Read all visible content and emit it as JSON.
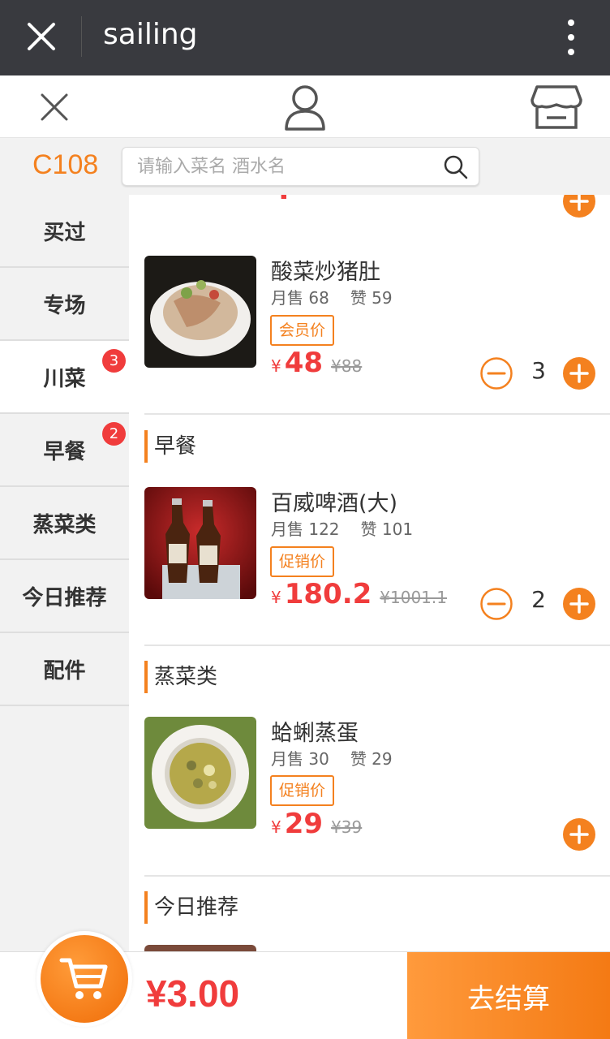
{
  "window": {
    "title": "sailing"
  },
  "table": {
    "number": "C108"
  },
  "search": {
    "placeholder": "请输入菜名 酒水名"
  },
  "sidebar": {
    "items": [
      {
        "label": "买过"
      },
      {
        "label": "专场"
      },
      {
        "label": "川菜",
        "badge": "3",
        "active": true
      },
      {
        "label": "早餐",
        "badge": "2"
      },
      {
        "label": "蒸菜类"
      },
      {
        "label": "今日推荐"
      },
      {
        "label": "配件"
      }
    ]
  },
  "dishes": [
    {
      "name": "酸菜炒猪肚",
      "sales": "月售 68",
      "likes": "赞 59",
      "tag": "会员价",
      "yen": "¥",
      "price": "48",
      "old_price": "¥88",
      "quantity": "3"
    },
    {
      "name": "百威啤酒(大)",
      "sales": "月售 122",
      "likes": "赞 101",
      "tag": "促销价",
      "yen": "¥",
      "price": "180.2",
      "old_price": "¥1001.1",
      "quantity": "2"
    },
    {
      "name": "蛤蜊蒸蛋",
      "sales": "月售 30",
      "likes": "赞 29",
      "tag": "促销价",
      "yen": "¥",
      "price": "29",
      "old_price": "¥39"
    }
  ],
  "sections": [
    "早餐",
    "蒸菜类",
    "今日推荐"
  ],
  "cart": {
    "total": "¥3.00"
  },
  "checkout": {
    "label": "去结算"
  },
  "colors": {
    "accent": "#f4811f",
    "price": "#f03c3c",
    "topbar": "#393a3f"
  }
}
